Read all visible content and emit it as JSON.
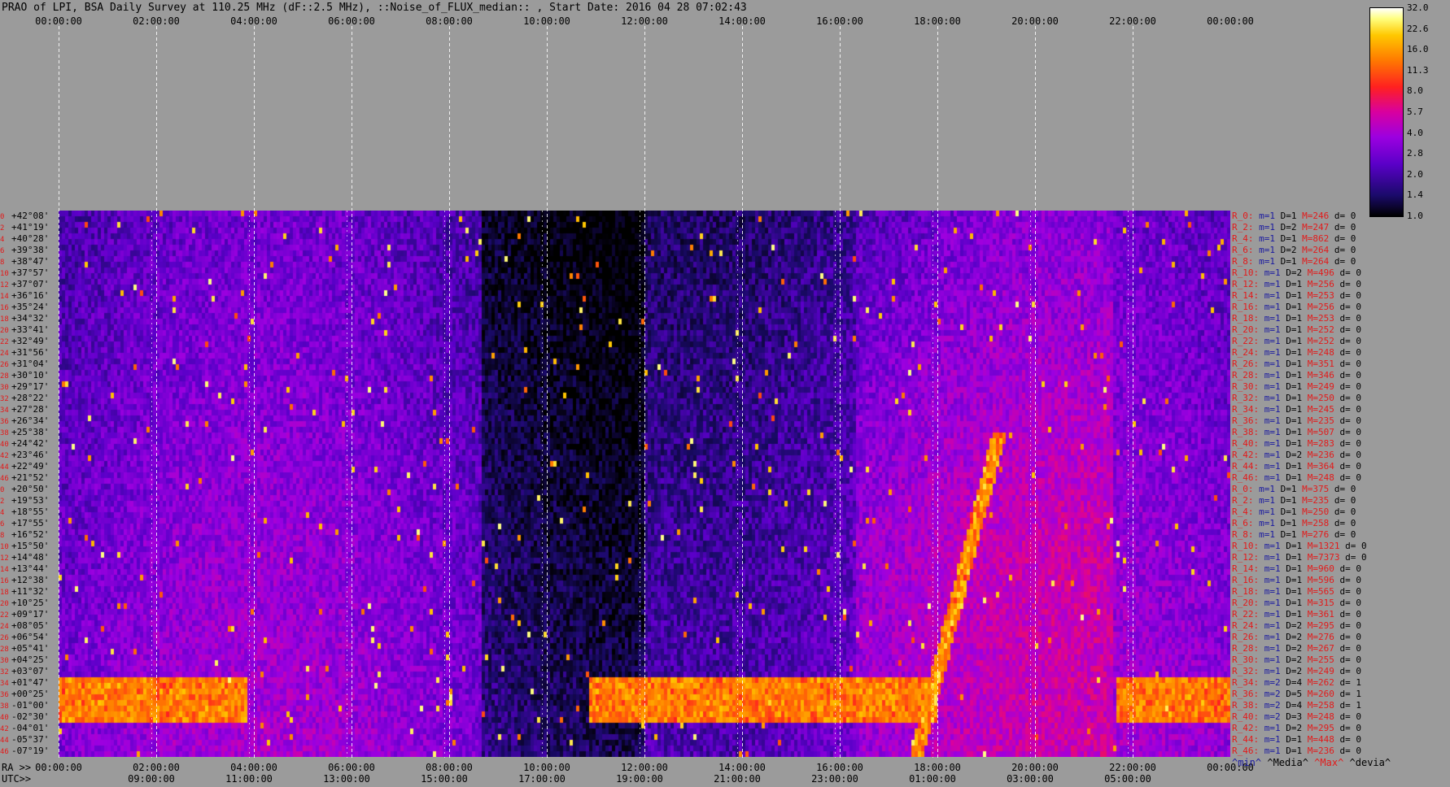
{
  "title": "PRAO of LPI, BSA Daily Survey at 110.25 MHz (dF::2.5 MHz), ::Noise_of_FLUX_median:: , Start Date: 2016 04 28 07:02:43",
  "ra_axis_label": "RA >>",
  "utc_axis_label": "UTC>>",
  "chart_data": {
    "type": "heatmap",
    "title": "PRAO of LPI, BSA Daily Survey at 110.25 MHz (dF::2.5 MHz), ::Noise_of_FLUX_median:: , Start Date: 2016 04 28 07:02:43",
    "x_ticks_top": [
      "00:00:00",
      "02:00:00",
      "04:00:00",
      "06:00:00",
      "08:00:00",
      "10:00:00",
      "12:00:00",
      "14:00:00",
      "16:00:00",
      "18:00:00",
      "20:00:00",
      "22:00:00",
      "00:00:00"
    ],
    "x_ticks_ra": [
      "00:00:00",
      "02:00:00",
      "04:00:00",
      "06:00:00",
      "08:00:00",
      "10:00:00",
      "12:00:00",
      "14:00:00",
      "16:00:00",
      "18:00:00",
      "20:00:00",
      "22:00:00",
      "00:00:00"
    ],
    "x_ticks_utc": [
      "09:00:00",
      "11:00:00",
      "13:00:00",
      "15:00:00",
      "17:00:00",
      "19:00:00",
      "21:00:00",
      "23:00:00",
      "01:00:00",
      "03:00:00",
      "05:00:00"
    ],
    "y_ticks_dec": [
      "+42°08'",
      "+41°19'",
      "+40°28'",
      "+39°38'",
      "+38°47'",
      "+37°57'",
      "+37°07'",
      "+36°16'",
      "+35°24'",
      "+34°32'",
      "+33°41'",
      "+32°49'",
      "+31°56'",
      "+31°04'",
      "+30°10'",
      "+29°17'",
      "+28°22'",
      "+27°28'",
      "+26°34'",
      "+25°38'",
      "+24°42'",
      "+23°46'",
      "+22°49'",
      "+21°52'",
      "+20°50'",
      "+19°53'",
      "+18°55'",
      "+17°55'",
      "+16°52'",
      "+15°50'",
      "+14°48'",
      "+13°44'",
      "+12°38'",
      "+11°32'",
      "+10°25'",
      "+09°17'",
      "+08°05'",
      "+06°54'",
      "+05°41'",
      "+04°25'",
      "+03°07'",
      "+01°47'",
      "+00°25'",
      "-01°00'",
      "-02°30'",
      "-04°01'",
      "-05°37'",
      "-07°19'"
    ],
    "y_ticks_index": [
      "0",
      "2",
      "4",
      "6",
      "8",
      "10",
      "12",
      "14",
      "16",
      "18",
      "20",
      "22",
      "24",
      "26",
      "28",
      "30",
      "32",
      "34",
      "36",
      "38",
      "40",
      "42",
      "44",
      "46",
      "0",
      "2",
      "4",
      "6",
      "8",
      "10",
      "12",
      "14",
      "16",
      "18",
      "20",
      "22",
      "24",
      "26",
      "28",
      "30",
      "32",
      "34",
      "36",
      "38",
      "40",
      "42",
      "44",
      "46"
    ],
    "colorbar": {
      "ticks": [
        "32.0",
        "22.6",
        "16.0",
        "11.3",
        "8.0",
        "5.7",
        "4.0",
        "2.8",
        "2.0",
        "1.4",
        "1.0"
      ],
      "colors": [
        "#000000",
        "#1a0a6a",
        "#5a00c8",
        "#9c00e0",
        "#d800a0",
        "#ff2020",
        "#ff7a00",
        "#ffc800",
        "#ffff80",
        "#ffffff"
      ]
    },
    "grid": true
  },
  "row_stats": [
    {
      "r": "R_0:",
      "m": "m=1",
      "d": "D=1",
      "mx": "M=246",
      "dv": "d= 0"
    },
    {
      "r": "R_2:",
      "m": "m=1",
      "d": "D=2",
      "mx": "M=247",
      "dv": "d= 0"
    },
    {
      "r": "R_4:",
      "m": "m=1",
      "d": "D=1",
      "mx": "M=862",
      "dv": "d= 0"
    },
    {
      "r": "R_6:",
      "m": "m=1",
      "d": "D=2",
      "mx": "M=264",
      "dv": "d= 0"
    },
    {
      "r": "R_8:",
      "m": "m=1",
      "d": "D=1",
      "mx": "M=264",
      "dv": "d= 0"
    },
    {
      "r": "R_10:",
      "m": "m=1",
      "d": "D=2",
      "mx": "M=496",
      "dv": "d= 0"
    },
    {
      "r": "R_12:",
      "m": "m=1",
      "d": "D=1",
      "mx": "M=256",
      "dv": "d= 0"
    },
    {
      "r": "R_14:",
      "m": "m=1",
      "d": "D=1",
      "mx": "M=253",
      "dv": "d= 0"
    },
    {
      "r": "R_16:",
      "m": "m=1",
      "d": "D=1",
      "mx": "M=256",
      "dv": "d= 0"
    },
    {
      "r": "R_18:",
      "m": "m=1",
      "d": "D=1",
      "mx": "M=253",
      "dv": "d= 0"
    },
    {
      "r": "R_20:",
      "m": "m=1",
      "d": "D=1",
      "mx": "M=252",
      "dv": "d= 0"
    },
    {
      "r": "R_22:",
      "m": "m=1",
      "d": "D=1",
      "mx": "M=252",
      "dv": "d= 0"
    },
    {
      "r": "R_24:",
      "m": "m=1",
      "d": "D=1",
      "mx": "M=248",
      "dv": "d= 0"
    },
    {
      "r": "R_26:",
      "m": "m=1",
      "d": "D=1",
      "mx": "M=351",
      "dv": "d= 0"
    },
    {
      "r": "R_28:",
      "m": "m=1",
      "d": "D=1",
      "mx": "M=346",
      "dv": "d= 0"
    },
    {
      "r": "R_30:",
      "m": "m=1",
      "d": "D=1",
      "mx": "M=249",
      "dv": "d= 0"
    },
    {
      "r": "R_32:",
      "m": "m=1",
      "d": "D=1",
      "mx": "M=250",
      "dv": "d= 0"
    },
    {
      "r": "R_34:",
      "m": "m=1",
      "d": "D=1",
      "mx": "M=245",
      "dv": "d= 0"
    },
    {
      "r": "R_36:",
      "m": "m=1",
      "d": "D=1",
      "mx": "M=235",
      "dv": "d= 0"
    },
    {
      "r": "R_38:",
      "m": "m=1",
      "d": "D=1",
      "mx": "M=507",
      "dv": "d= 0"
    },
    {
      "r": "R_40:",
      "m": "m=1",
      "d": "D=1",
      "mx": "M=283",
      "dv": "d= 0"
    },
    {
      "r": "R_42:",
      "m": "m=1",
      "d": "D=2",
      "mx": "M=236",
      "dv": "d= 0"
    },
    {
      "r": "R_44:",
      "m": "m=1",
      "d": "D=1",
      "mx": "M=364",
      "dv": "d= 0"
    },
    {
      "r": "R_46:",
      "m": "m=1",
      "d": "D=1",
      "mx": "M=248",
      "dv": "d= 0"
    },
    {
      "r": "R_0:",
      "m": "m=1",
      "d": "D=1",
      "mx": "M=375",
      "dv": "d= 0"
    },
    {
      "r": "R_2:",
      "m": "m=1",
      "d": "D=1",
      "mx": "M=235",
      "dv": "d= 0"
    },
    {
      "r": "R_4:",
      "m": "m=1",
      "d": "D=1",
      "mx": "M=250",
      "dv": "d= 0"
    },
    {
      "r": "R_6:",
      "m": "m=1",
      "d": "D=1",
      "mx": "M=258",
      "dv": "d= 0"
    },
    {
      "r": "R_8:",
      "m": "m=1",
      "d": "D=1",
      "mx": "M=276",
      "dv": "d= 0"
    },
    {
      "r": "R_10:",
      "m": "m=1",
      "d": "D=1",
      "mx": "M=1321",
      "dv": "d= 0"
    },
    {
      "r": "R_12:",
      "m": "m=1",
      "d": "D=1",
      "mx": "M=7373",
      "dv": "d= 0"
    },
    {
      "r": "R_14:",
      "m": "m=1",
      "d": "D=1",
      "mx": "M=960",
      "dv": "d= 0"
    },
    {
      "r": "R_16:",
      "m": "m=1",
      "d": "D=1",
      "mx": "M=596",
      "dv": "d= 0"
    },
    {
      "r": "R_18:",
      "m": "m=1",
      "d": "D=1",
      "mx": "M=565",
      "dv": "d= 0"
    },
    {
      "r": "R_20:",
      "m": "m=1",
      "d": "D=1",
      "mx": "M=315",
      "dv": "d= 0"
    },
    {
      "r": "R_22:",
      "m": "m=1",
      "d": "D=1",
      "mx": "M=361",
      "dv": "d= 0"
    },
    {
      "r": "R_24:",
      "m": "m=1",
      "d": "D=2",
      "mx": "M=295",
      "dv": "d= 0"
    },
    {
      "r": "R_26:",
      "m": "m=1",
      "d": "D=2",
      "mx": "M=276",
      "dv": "d= 0"
    },
    {
      "r": "R_28:",
      "m": "m=1",
      "d": "D=2",
      "mx": "M=267",
      "dv": "d= 0"
    },
    {
      "r": "R_30:",
      "m": "m=1",
      "d": "D=2",
      "mx": "M=255",
      "dv": "d= 0"
    },
    {
      "r": "R_32:",
      "m": "m=1",
      "d": "D=2",
      "mx": "M=249",
      "dv": "d= 0"
    },
    {
      "r": "R_34:",
      "m": "m=2",
      "d": "D=4",
      "mx": "M=262",
      "dv": "d= 1"
    },
    {
      "r": "R_36:",
      "m": "m=2",
      "d": "D=5",
      "mx": "M=260",
      "dv": "d= 1"
    },
    {
      "r": "R_38:",
      "m": "m=2",
      "d": "D=4",
      "mx": "M=258",
      "dv": "d= 1"
    },
    {
      "r": "R_40:",
      "m": "m=2",
      "d": "D=3",
      "mx": "M=248",
      "dv": "d= 0"
    },
    {
      "r": "R_42:",
      "m": "m=1",
      "d": "D=2",
      "mx": "M=295",
      "dv": "d= 0"
    },
    {
      "r": "R_44:",
      "m": "m=1",
      "d": "D=1",
      "mx": "M=448",
      "dv": "d= 0"
    },
    {
      "r": "R_46:",
      "m": "m=1",
      "d": "D=1",
      "mx": "M=236",
      "dv": "d= 0"
    }
  ],
  "legend_foot": {
    "min": "^min^",
    "med": "^Media^",
    "max": "^Max^",
    "dev": "^devia^"
  }
}
